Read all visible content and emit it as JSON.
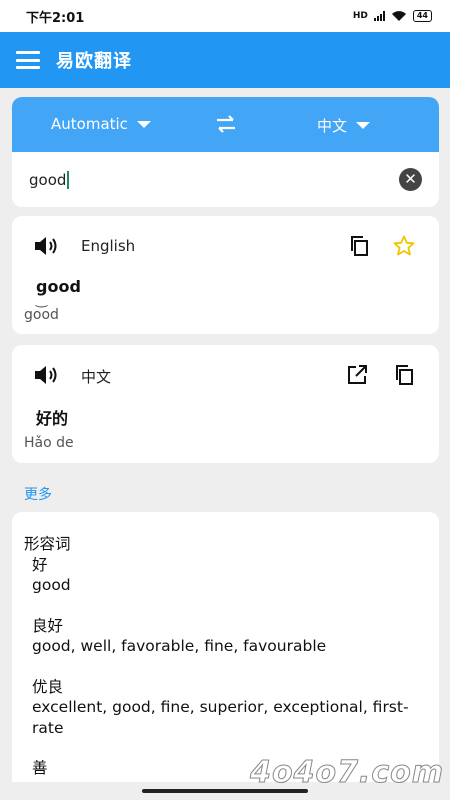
{
  "status": {
    "time": "下午2:01",
    "battery": "44",
    "network": "HD"
  },
  "app": {
    "title": "易欧翻译"
  },
  "translator": {
    "source_lang": "Automatic",
    "target_lang": "中文",
    "input_value": "good"
  },
  "result_en": {
    "lang": "English",
    "word": "good",
    "phonetic": "go͝od"
  },
  "result_zh": {
    "lang": "中文",
    "word": "好的",
    "phonetic": "Hǎo de"
  },
  "more_label": "更多",
  "dictionary": {
    "pos": "形容词",
    "entries": [
      {
        "term": "好",
        "gloss": "good"
      },
      {
        "term": "良好",
        "gloss": "good, well, favorable, fine, favourable"
      },
      {
        "term": "优良",
        "gloss": "excellent, good, fine, superior, exceptional, first-rate"
      },
      {
        "term": "善",
        "gloss": ""
      }
    ]
  },
  "watermark": "4o4o7.com",
  "colors": {
    "primary": "#2196f3",
    "lang_bar": "#42a5f5",
    "star": "#f2c400"
  }
}
